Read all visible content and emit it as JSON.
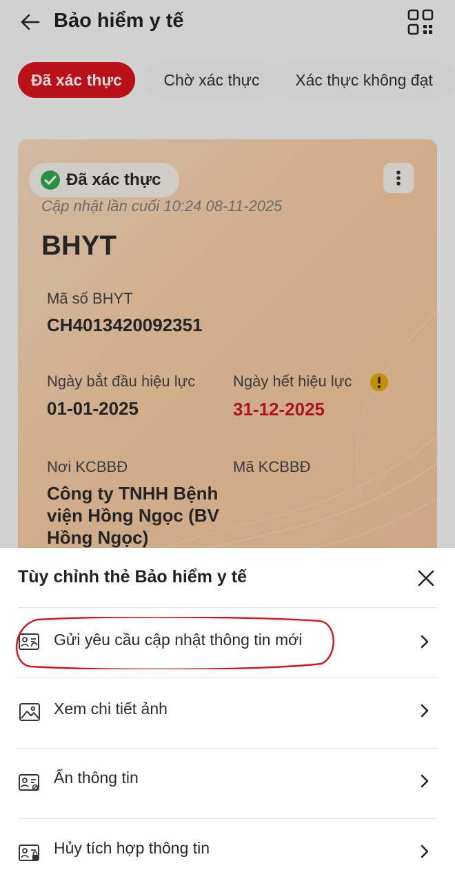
{
  "header": {
    "title": "Bảo hiểm y tế",
    "back_icon": "arrow-left-icon",
    "qr_icon": "qr-code-icon"
  },
  "tabs": [
    {
      "label": "Đã xác thực",
      "active": true
    },
    {
      "label": "Chờ xác thực",
      "active": false
    },
    {
      "label": "Xác thực không đạt",
      "active": false
    }
  ],
  "card": {
    "status": "Đã xác thực",
    "updated": "Cập nhật lần cuối 10:24 08-11-2025",
    "type": "BHYT",
    "insurance_number_label": "Mã số BHYT",
    "insurance_number": "CH4013420092351",
    "start_label": "Ngày bắt đầu hiệu lực",
    "start_date": "01-01-2025",
    "end_label": "Ngày hết hiệu lực",
    "end_date": "31-12-2025",
    "facility_label": "Nơi KCBBĐ",
    "facility_line1": "Công ty TNHH Bệnh",
    "facility_line2": "viện Hồng Ngọc (BV",
    "facility_line3": "Hồng Ngọc)",
    "facility_code_label": "Mã KCBBĐ"
  },
  "sheet": {
    "title": "Tùy chỉnh thẻ Bảo hiểm y tế",
    "items": [
      {
        "label": "Gửi yêu cầu cập nhật thông tin mới",
        "icon": "id-card-refresh-icon"
      },
      {
        "label": "Xem chi tiết ảnh",
        "icon": "image-icon"
      },
      {
        "label": "Ẩn thông tin",
        "icon": "id-card-hide-icon"
      },
      {
        "label": "Hủy tích hợp thông tin",
        "icon": "id-card-lock-icon"
      }
    ]
  },
  "colors": {
    "brand_red": "#d7141b",
    "success_green": "#2fa84f",
    "warning_yellow": "#e0a800",
    "expiry_red": "#c61a1f"
  }
}
